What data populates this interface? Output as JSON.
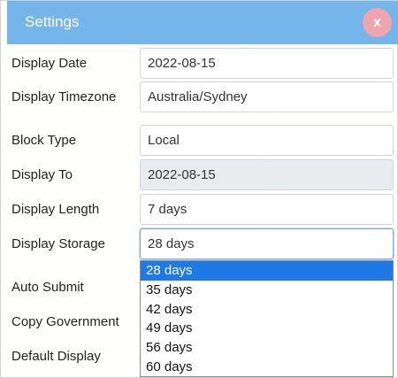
{
  "modal": {
    "title": "Settings",
    "close_label": "x"
  },
  "fields": [
    {
      "label": "Display Date",
      "value": "2022-08-15"
    },
    {
      "label": "Display Timezone",
      "value": "Australia/Sydney"
    },
    {
      "label": "Block Type",
      "value": "Local"
    },
    {
      "label": "Display To",
      "value": "2022-08-15"
    },
    {
      "label": "Display Length",
      "value": "7 days"
    },
    {
      "label": "Display Storage",
      "value": "28 days"
    },
    {
      "label": "Auto Submit"
    },
    {
      "label": "Copy Government"
    },
    {
      "label": "Default Display"
    }
  ],
  "storage_dropdown": {
    "options": [
      "28 days",
      "35 days",
      "42 days",
      "49 days",
      "56 days",
      "60 days"
    ],
    "selected": "28 days"
  },
  "colors": {
    "header": "#75b5ea",
    "close_button": "#f0a4ad",
    "selected_option": "#1e78e6"
  }
}
